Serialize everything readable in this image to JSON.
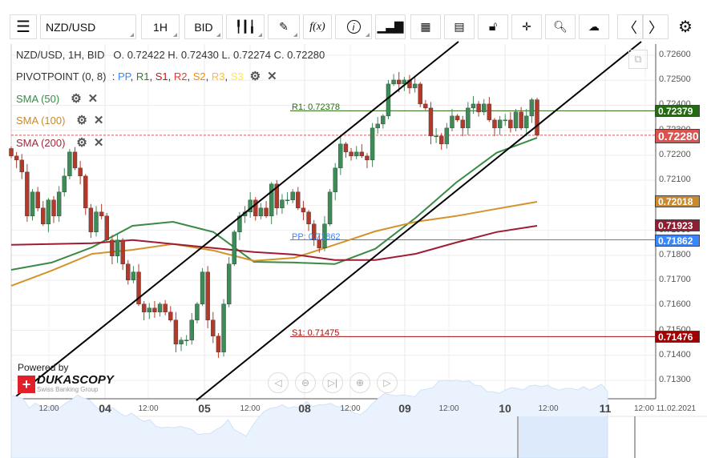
{
  "toolbar": {
    "symbol": "NZD/USD",
    "timeframe": "1H",
    "price_type": "BID",
    "fx_label": "f(x)"
  },
  "legend": {
    "title": "NZD/USD, 1H, BID",
    "ohlc": "O. 0.72422 H. 0.72430 L. 0.72274 C. 0.72280",
    "pivot": "PIVOTPOINT (0, 8)",
    "pivot_sep": ":",
    "pivot_items": [
      {
        "t": "PP",
        "c": "#3a86ff"
      },
      {
        "t": "R1",
        "c": "#2e7d32"
      },
      {
        "t": "S1",
        "c": "#b71c1c"
      },
      {
        "t": "R2",
        "c": "#e53935"
      },
      {
        "t": "S2",
        "c": "#fb8c00"
      },
      {
        "t": "R3",
        "c": "#fbc02d"
      },
      {
        "t": "S3",
        "c": "#ffeb3b"
      }
    ],
    "sma50": "SMA (50)",
    "sma100": "SMA (100)",
    "sma200": "SMA (200)"
  },
  "price_axis": [
    "0.72600",
    "0.72500",
    "0.72400",
    "0.72300",
    "0.72200",
    "0.72100",
    "0.72000",
    "0.71900",
    "0.71800",
    "0.71700",
    "0.71600",
    "0.71500",
    "0.71400",
    "0.71300"
  ],
  "tags": {
    "r1": "0.72379",
    "current": "0.72280",
    "sma100": "0.72018",
    "sma200": "0.71923",
    "pp": "0.71862",
    "s1": "0.71476"
  },
  "levels": {
    "r1_label": "R1: 0.72378",
    "pp_label": "PP: 0.71862",
    "s1_label": "S1: 0.71475"
  },
  "time_axis": {
    "minor": [
      "12:00",
      "12:00",
      "12:00",
      "12:00",
      "12:00",
      "12:00",
      "12:00"
    ],
    "days": [
      "04",
      "05",
      "08",
      "09",
      "10",
      "11"
    ],
    "last": "12:00 11.02.2021"
  },
  "branding": {
    "powered": "Powered by",
    "name": "DUKASCOPY",
    "sub": "Swiss Banking Group"
  },
  "colors": {
    "up": "#3d8b57",
    "down": "#b23a2b",
    "sma50": "#3a8a45",
    "sma100": "#d4932a",
    "sma200": "#a01c32",
    "r1": "#2a6a12",
    "pp": "#3a86ff",
    "s1": "#a50f0f",
    "current": "#d9534f"
  },
  "chart_data": {
    "type": "candlestick",
    "symbol": "NZD/USD",
    "interval": "1H",
    "ylim": [
      0.7128,
      0.7265
    ],
    "closes": [
      0.72197,
      0.72181,
      0.72133,
      0.71957,
      0.72053,
      0.71989,
      0.71925,
      0.72021,
      0.71957,
      0.72053,
      0.72117,
      0.72213,
      0.72149,
      0.72117,
      0.71989,
      0.71893,
      0.71973,
      0.71957,
      0.71861,
      0.71797,
      0.71861,
      0.71765,
      0.71701,
      0.71733,
      0.71605,
      0.71573,
      0.71589,
      0.71573,
      0.71605,
      0.71573,
      0.71541,
      0.71445,
      0.71461,
      0.71461,
      0.71541,
      0.71605,
      0.71733,
      0.71541,
      0.71477,
      0.71413,
      0.71605,
      0.71765,
      0.71893,
      0.71957,
      0.71973,
      0.72021,
      0.71957,
      0.71989,
      0.71957,
      0.72085,
      0.71989,
      0.72021,
      0.72021,
      0.72053,
      0.71989,
      0.71973,
      0.71925,
      0.71861,
      0.71829,
      0.71925,
      0.72053,
      0.72149,
      0.72245,
      0.72213,
      0.72197,
      0.72213,
      0.72197,
      0.72181,
      0.72309,
      0.72325,
      0.72357,
      0.72485,
      0.72501,
      0.72485,
      0.72501,
      0.72469,
      0.72485,
      0.72405,
      0.72389,
      0.72277,
      0.72277,
      0.72245,
      0.72309,
      0.72357,
      0.72341,
      0.72309,
      0.72389,
      0.72405,
      0.72373,
      0.72405,
      0.72341,
      0.72309,
      0.72341,
      0.72341,
      0.72309,
      0.72373,
      0.72309,
      0.72357,
      0.72422,
      0.7228
    ],
    "sma50": [
      0.71742,
      0.71771,
      0.71832,
      0.71918,
      0.71934,
      0.71893,
      0.71774,
      0.71771,
      0.71765,
      0.71826,
      0.7195,
      0.72091,
      0.7221,
      0.7227
    ],
    "sma100": [
      0.71678,
      0.71739,
      0.71806,
      0.71822,
      0.71845,
      0.71819,
      0.71778,
      0.7179,
      0.71842,
      0.71896,
      0.71934,
      0.71957,
      0.71986,
      0.72014
    ],
    "sma200": [
      0.71842,
      0.71845,
      0.71848,
      0.71861,
      0.71845,
      0.71829,
      0.71813,
      0.71803,
      0.71781,
      0.71781,
      0.71806,
      0.71851,
      0.71893,
      0.71918
    ],
    "pivots": {
      "R1": 0.72378,
      "PP": 0.71862,
      "S1": 0.71475
    },
    "last": {
      "open": 0.72422,
      "high": 0.7243,
      "low": 0.72274,
      "close": 0.7228
    }
  }
}
